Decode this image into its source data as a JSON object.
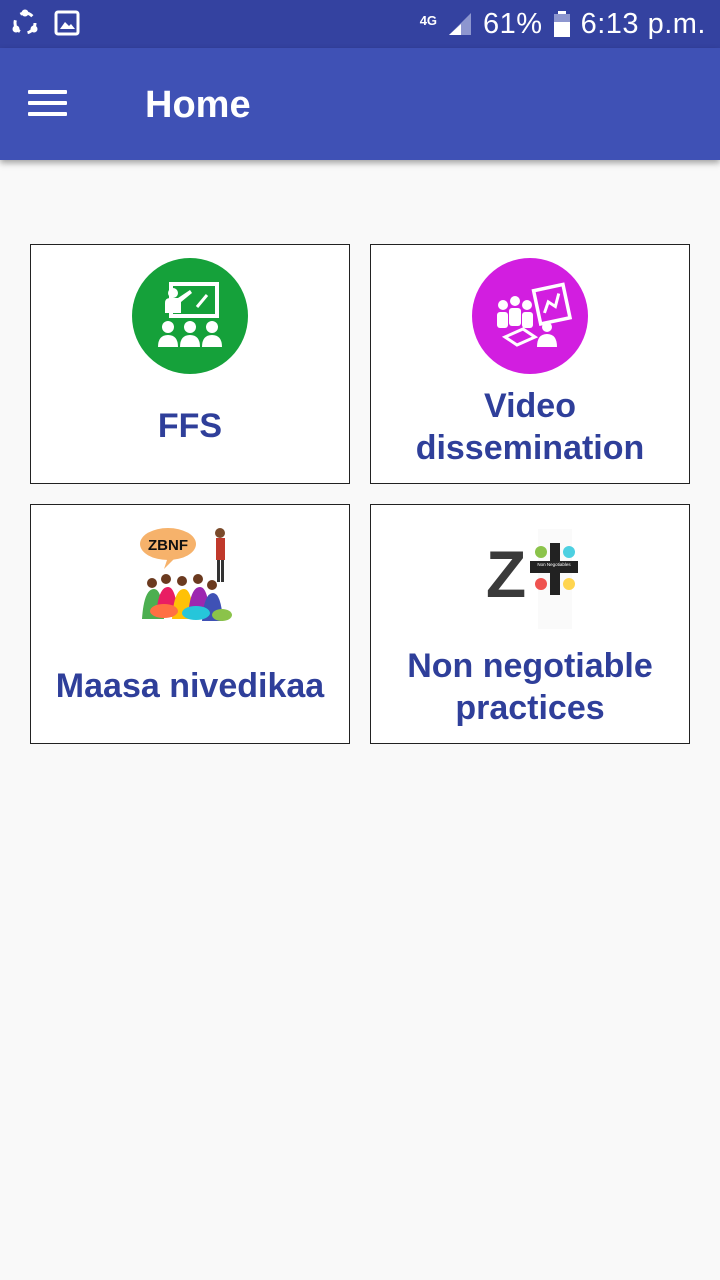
{
  "status_bar": {
    "network": "4G",
    "battery": "61%",
    "time": "6:13 p.m."
  },
  "app_bar": {
    "title": "Home",
    "menu_icon": "hamburger-menu-icon"
  },
  "tiles": [
    {
      "label": "FFS",
      "icon": "classroom-icon",
      "icon_color": "#15a13a"
    },
    {
      "label": "Video dissemination",
      "icon": "presentation-icon",
      "icon_color": "#d21ee0"
    },
    {
      "label": "Maasa nivedikaa",
      "icon": "zbnf-meeting-illustration",
      "icon_badge": "ZBNF"
    },
    {
      "label": "Non negotiable practices",
      "icon": "z-plus-logo",
      "logo_letter": "Z",
      "logo_text": "Non Negotiables"
    }
  ],
  "colors": {
    "status_bar": "#3442a0",
    "app_bar": "#3f51b5",
    "tile_label": "#2f3f9a",
    "background": "#f9f9f9"
  }
}
